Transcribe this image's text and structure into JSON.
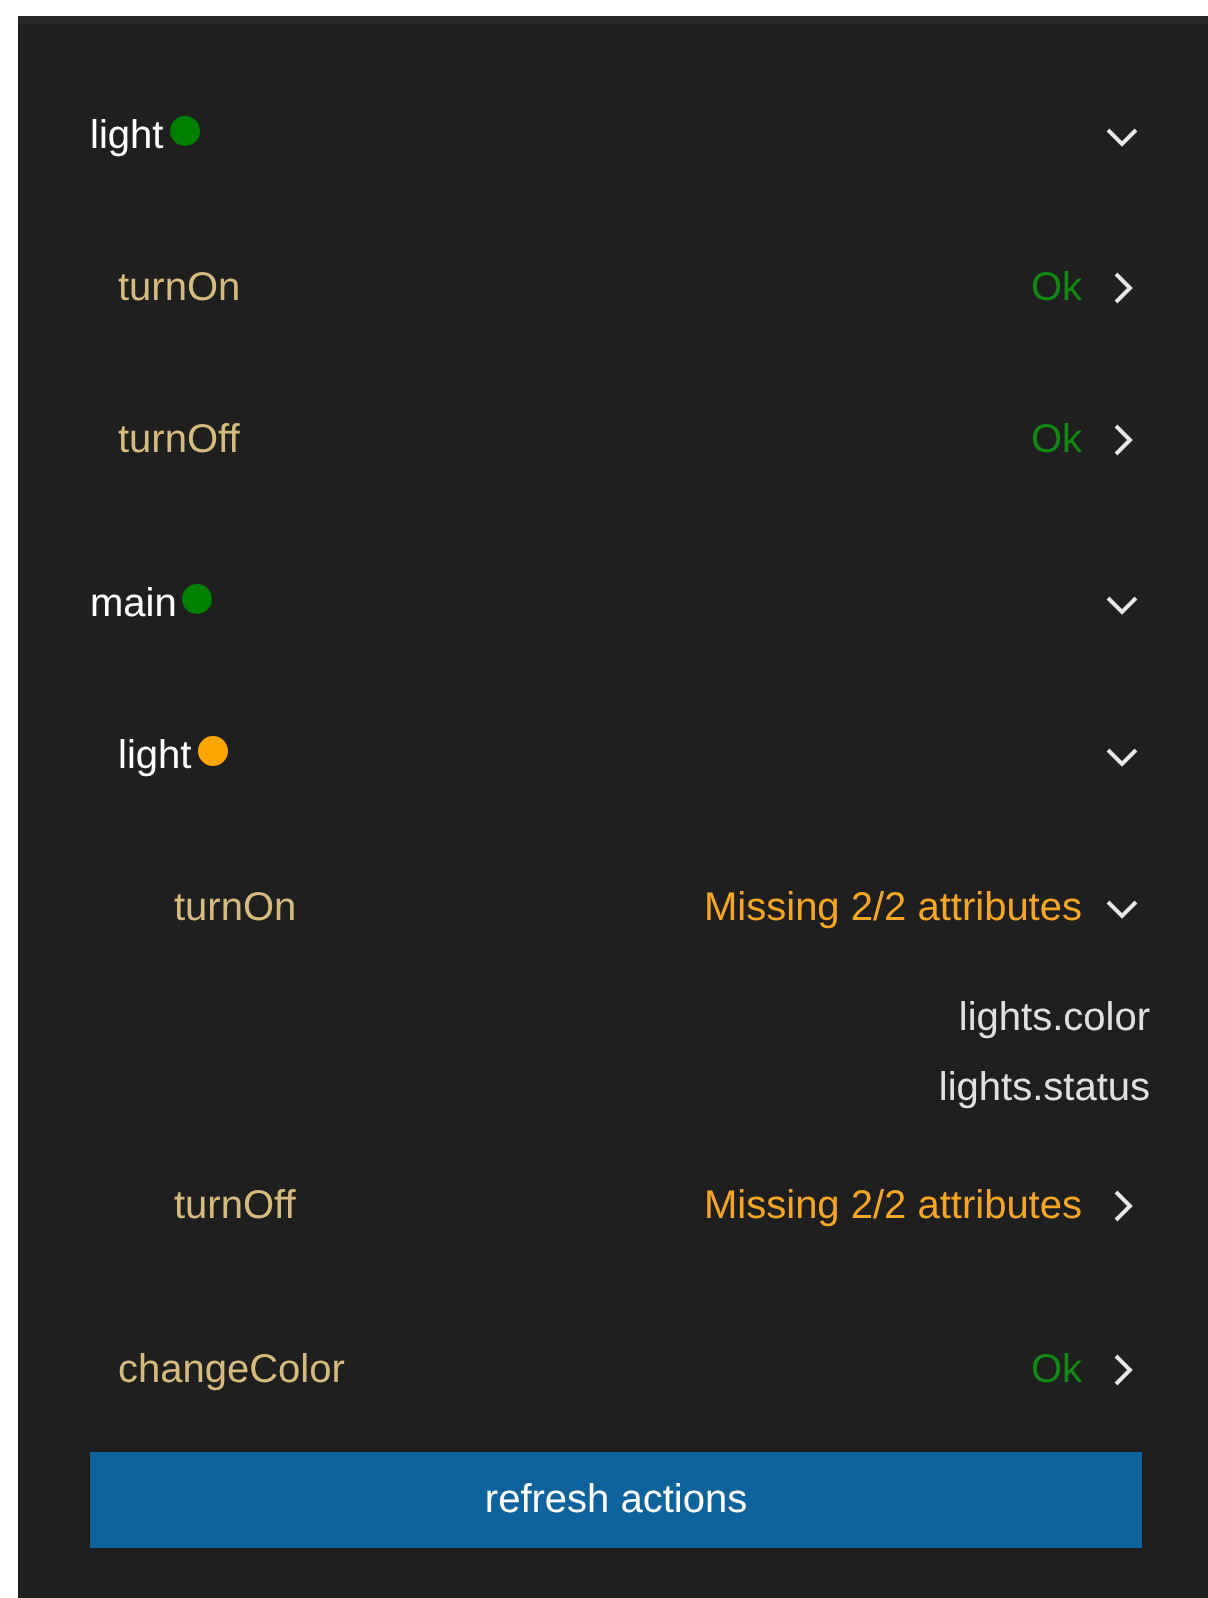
{
  "groups": [
    {
      "name": "light",
      "color": "#008000",
      "expanded": true,
      "children": [
        {
          "kind": "action",
          "name": "turnOn",
          "status": "Ok",
          "color": "#138a13",
          "expanded": false
        },
        {
          "kind": "action",
          "name": "turnOff",
          "status": "Ok",
          "color": "#138a13",
          "expanded": false
        }
      ]
    },
    {
      "name": "main",
      "color": "#008000",
      "expanded": true,
      "children": [
        {
          "kind": "group",
          "name": "light",
          "color": "#ffa500",
          "expanded": true,
          "children": [
            {
              "kind": "action",
              "name": "turnOn",
              "status": "Missing 2/2 attributes",
              "color": "#f5a623",
              "expanded": true,
              "missing": [
                "lights.color",
                "lights.status"
              ]
            },
            {
              "kind": "action",
              "name": "turnOff",
              "status": "Missing 2/2 attributes",
              "color": "#f5a623",
              "expanded": false
            }
          ]
        },
        {
          "kind": "action",
          "name": "changeColor",
          "status": "Ok",
          "color": "#138a13",
          "expanded": false
        }
      ]
    }
  ],
  "button": "refresh actions"
}
